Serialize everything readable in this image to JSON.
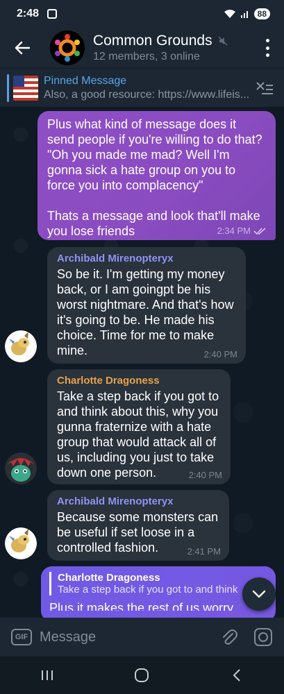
{
  "status": {
    "time": "2:48",
    "battery": "88"
  },
  "header": {
    "title": "Common Grounds",
    "subtitle": "12 members, 3 online"
  },
  "pinned": {
    "label": "Pinned Message",
    "preview": "Also, a good resource: https://www.lifeis..."
  },
  "messages": [
    {
      "direction": "outgoing",
      "text": "Plus what kind of message does it send people if you're willing to do that? \"Oh you made me mad? Well I'm gonna sick a hate group on you to force you into complacency\"\n\nThats a message and look that'll make you lose friends",
      "time": "2:34 PM"
    },
    {
      "direction": "incoming",
      "sender": "Archibald Mirenopteryx",
      "sender_color": "#8e93f5",
      "text": "So be it. I'm getting my money back, or I am goingpt be his worst nightmare. And that's how it's going to be. He made his choice. Time for me to make mine.",
      "time": "2:40 PM"
    },
    {
      "direction": "incoming",
      "sender": "Charlotte Dragoness",
      "sender_color": "#e6a34a",
      "text": "Take a step back if you got to and think about this, why you gunna fraternize with a hate group that would attack all of us, including you just to take down one person.",
      "time": "2:40 PM"
    },
    {
      "direction": "incoming",
      "sender": "Archibald Mirenopteryx",
      "sender_color": "#8e93f5",
      "text": "Because some monsters can be useful if set loose in a controlled fashion.",
      "time": "2:41 PM"
    },
    {
      "direction": "outgoing",
      "reply_to": {
        "sender": "Charlotte Dragoness",
        "text": "Take a step back if you got to and think"
      },
      "text": "Plus it makes the rest of us worry"
    }
  ],
  "composer": {
    "placeholder": "Message",
    "gif_label": "GIF"
  },
  "colors": {
    "accent": "#5aa6e8",
    "outgoing_bubble": "#8e4ec6",
    "incoming_bubble": "#2a323b",
    "reply_bubble": "#7758e0"
  }
}
